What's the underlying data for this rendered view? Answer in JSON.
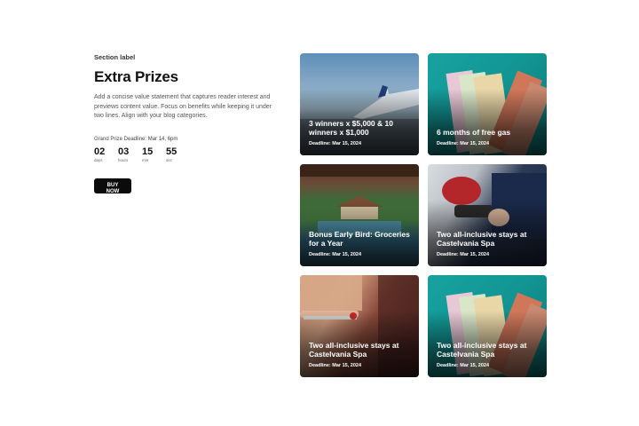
{
  "hero": {
    "section_label": "Section label",
    "title": "Extra Prizes",
    "description": "Add a concise value statement that captures reader interest and previews content value. Focus on benefits while keeping it under two lines. Align with your blog categories.",
    "deadline_label": "Grand Prize Deadline: Mar 14, 6pm",
    "countdown": [
      {
        "value": "02",
        "unit": "days"
      },
      {
        "value": "03",
        "unit": "hours"
      },
      {
        "value": "15",
        "unit": "min"
      },
      {
        "value": "55",
        "unit": "sec"
      }
    ],
    "buy_label": "BUY NOW"
  },
  "cards": [
    {
      "title": "3 winners x $5,000 & 10 winners x $1,000",
      "deadline": "Deadline: Mar 15, 2024",
      "image": "airplane-wing-sky"
    },
    {
      "title": "6 months of free gas",
      "deadline": "Deadline: Mar 15, 2024",
      "image": "banknotes"
    },
    {
      "title": "Bonus Early Bird: Groceries for a Year",
      "deadline": "Deadline: Mar 15, 2024",
      "image": "resort-pool"
    },
    {
      "title": "Two all-inclusive stays at Castelvania Spa",
      "deadline": "Deadline: Mar 15, 2024",
      "image": "gas-pump"
    },
    {
      "title": "Two all-inclusive stays at Castelvania Spa",
      "deadline": "Deadline: Mar 15, 2024",
      "image": "shopping-cart"
    },
    {
      "title": "Two all-inclusive stays at Castelvania Spa",
      "deadline": "Deadline: Mar 15, 2024",
      "image": "banknotes"
    }
  ],
  "colors": {
    "button_bg": "#0b0b0b",
    "accent_teal": "#17a2a0"
  }
}
